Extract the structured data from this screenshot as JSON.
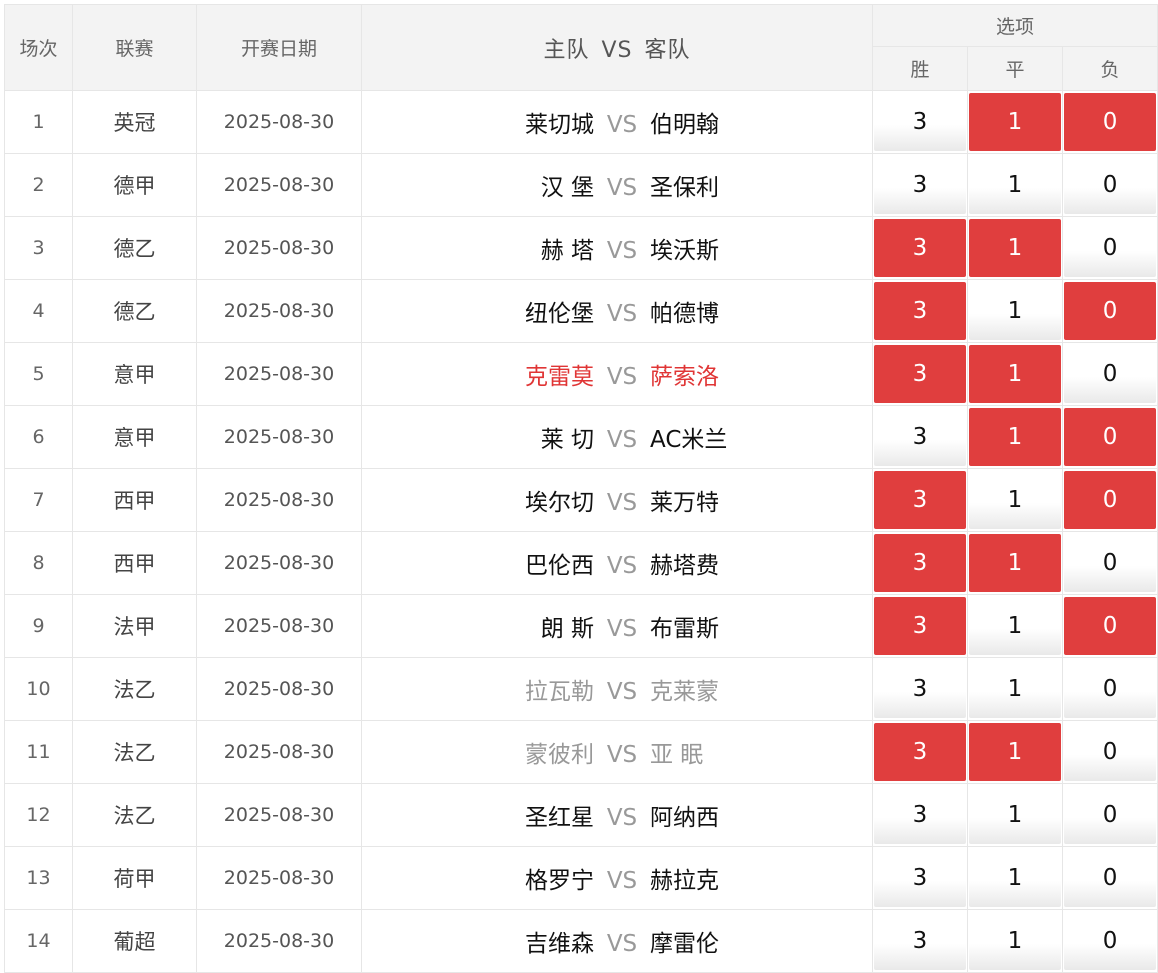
{
  "header": {
    "col_index": "场次",
    "col_league": "联赛",
    "col_date": "开赛日期",
    "col_home": "主队",
    "col_vs": "VS",
    "col_away": "客队",
    "col_options": "选项",
    "opt_win": "胜",
    "opt_draw": "平",
    "opt_lose": "负"
  },
  "colors": {
    "selected": "#e03e3e",
    "highlight_text": "#e03535",
    "muted_text": "#999999"
  },
  "rows": [
    {
      "idx": "1",
      "league": "英冠",
      "date": "2025-08-30",
      "home": "莱切城",
      "vs": "VS",
      "away": "伯明翰",
      "opts": [
        "3",
        "1",
        "0"
      ],
      "sel": [
        false,
        true,
        true
      ],
      "style": ""
    },
    {
      "idx": "2",
      "league": "德甲",
      "date": "2025-08-30",
      "home": "汉 堡",
      "vs": "VS",
      "away": "圣保利",
      "opts": [
        "3",
        "1",
        "0"
      ],
      "sel": [
        false,
        false,
        false
      ],
      "style": ""
    },
    {
      "idx": "3",
      "league": "德乙",
      "date": "2025-08-30",
      "home": "赫 塔",
      "vs": "VS",
      "away": "埃沃斯",
      "opts": [
        "3",
        "1",
        "0"
      ],
      "sel": [
        true,
        true,
        false
      ],
      "style": ""
    },
    {
      "idx": "4",
      "league": "德乙",
      "date": "2025-08-30",
      "home": "纽伦堡",
      "vs": "VS",
      "away": "帕德博",
      "opts": [
        "3",
        "1",
        "0"
      ],
      "sel": [
        true,
        false,
        true
      ],
      "style": ""
    },
    {
      "idx": "5",
      "league": "意甲",
      "date": "2025-08-30",
      "home": "克雷莫",
      "vs": "VS",
      "away": "萨索洛",
      "opts": [
        "3",
        "1",
        "0"
      ],
      "sel": [
        true,
        true,
        false
      ],
      "style": "hl"
    },
    {
      "idx": "6",
      "league": "意甲",
      "date": "2025-08-30",
      "home": "莱 切",
      "vs": "VS",
      "away": "AC米兰",
      "opts": [
        "3",
        "1",
        "0"
      ],
      "sel": [
        false,
        true,
        true
      ],
      "style": ""
    },
    {
      "idx": "7",
      "league": "西甲",
      "date": "2025-08-30",
      "home": "埃尔切",
      "vs": "VS",
      "away": "莱万特",
      "opts": [
        "3",
        "1",
        "0"
      ],
      "sel": [
        true,
        false,
        true
      ],
      "style": ""
    },
    {
      "idx": "8",
      "league": "西甲",
      "date": "2025-08-30",
      "home": "巴伦西",
      "vs": "VS",
      "away": "赫塔费",
      "opts": [
        "3",
        "1",
        "0"
      ],
      "sel": [
        true,
        true,
        false
      ],
      "style": ""
    },
    {
      "idx": "9",
      "league": "法甲",
      "date": "2025-08-30",
      "home": "朗 斯",
      "vs": "VS",
      "away": "布雷斯",
      "opts": [
        "3",
        "1",
        "0"
      ],
      "sel": [
        true,
        false,
        true
      ],
      "style": ""
    },
    {
      "idx": "10",
      "league": "法乙",
      "date": "2025-08-30",
      "home": "拉瓦勒",
      "vs": "VS",
      "away": "克莱蒙",
      "opts": [
        "3",
        "1",
        "0"
      ],
      "sel": [
        false,
        false,
        false
      ],
      "style": "muted"
    },
    {
      "idx": "11",
      "league": "法乙",
      "date": "2025-08-30",
      "home": "蒙彼利",
      "vs": "VS",
      "away": "亚 眠",
      "opts": [
        "3",
        "1",
        "0"
      ],
      "sel": [
        true,
        true,
        false
      ],
      "style": "muted"
    },
    {
      "idx": "12",
      "league": "法乙",
      "date": "2025-08-30",
      "home": "圣红星",
      "vs": "VS",
      "away": "阿纳西",
      "opts": [
        "3",
        "1",
        "0"
      ],
      "sel": [
        false,
        false,
        false
      ],
      "style": ""
    },
    {
      "idx": "13",
      "league": "荷甲",
      "date": "2025-08-30",
      "home": "格罗宁",
      "vs": "VS",
      "away": "赫拉克",
      "opts": [
        "3",
        "1",
        "0"
      ],
      "sel": [
        false,
        false,
        false
      ],
      "style": ""
    },
    {
      "idx": "14",
      "league": "葡超",
      "date": "2025-08-30",
      "home": "吉维森",
      "vs": "VS",
      "away": "摩雷伦",
      "opts": [
        "3",
        "1",
        "0"
      ],
      "sel": [
        false,
        false,
        false
      ],
      "style": ""
    }
  ]
}
